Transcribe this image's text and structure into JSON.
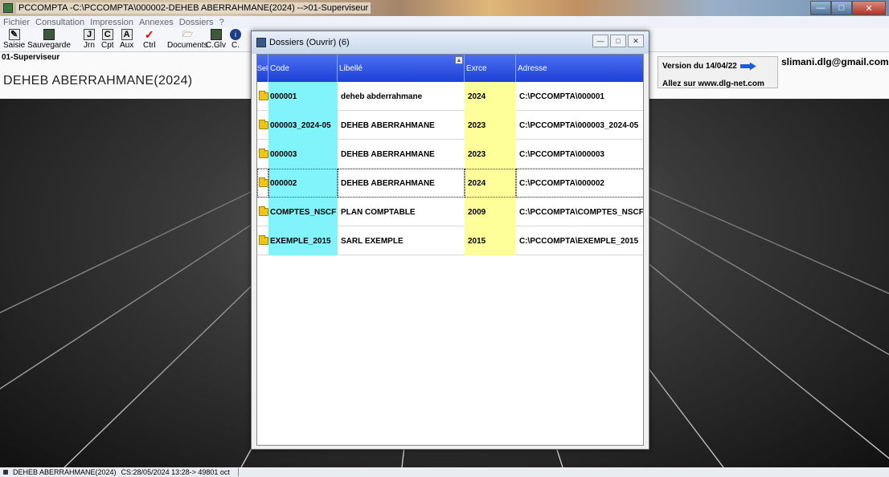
{
  "window": {
    "title": "PCCOMPTA -C:\\PCCOMPTA\\000002-DEHEB ABERRAHMANE(2024) -->01-Superviseur"
  },
  "menu": [
    "Fichier",
    "Consultation",
    "Impression",
    "Annexes",
    "Dossiers",
    "?"
  ],
  "toolbar": [
    {
      "label": "Saisie",
      "icon": "edit-icon"
    },
    {
      "label": "Sauvegarde",
      "icon": "save-icon"
    },
    {
      "label": "Jrn",
      "icon": "journal-icon"
    },
    {
      "label": "Cpt",
      "icon": "account-icon"
    },
    {
      "label": "Aux",
      "icon": "auxiliary-icon"
    },
    {
      "label": "Ctrl",
      "icon": "checkmark-icon"
    },
    {
      "label": "Documents",
      "icon": "folder-open-icon"
    },
    {
      "label": "C.Glv",
      "icon": "chart-icon"
    },
    {
      "label": "C.",
      "icon": "info-icon"
    }
  ],
  "header": {
    "user": "01-Superviseur",
    "dossier": "DEHEB ABERRAHMANE(2024)",
    "version": "Version du 14/04/22",
    "website": "Allez sur  www.dlg-net.com",
    "email": "slimani.dlg@gmail.com"
  },
  "dialog": {
    "title": "Dossiers (Ouvrir) (6)",
    "columns": [
      "Sel",
      "Code",
      "Libellé",
      "Exrce",
      "Adresse"
    ],
    "rows": [
      {
        "code": "000001",
        "libelle": "deheb abderrahmane",
        "exercice": "2024",
        "adresse": "C:\\PCCOMPTA\\000001"
      },
      {
        "code": "000003_2024-05",
        "libelle": "DEHEB ABERRAHMANE",
        "exercice": "2023",
        "adresse": "C:\\PCCOMPTA\\000003_2024-05"
      },
      {
        "code": "000003",
        "libelle": "DEHEB ABERRAHMANE",
        "exercice": "2023",
        "adresse": "C:\\PCCOMPTA\\000003"
      },
      {
        "code": "000002",
        "libelle": "DEHEB ABERRAHMANE",
        "exercice": "2024",
        "adresse": "C:\\PCCOMPTA\\000002"
      },
      {
        "code": "COMPTES_NSCF",
        "libelle": "PLAN COMPTABLE",
        "exercice": "2009",
        "adresse": "C:\\PCCOMPTA\\COMPTES_NSCF"
      },
      {
        "code": "EXEMPLE_2015",
        "libelle": "SARL EXEMPLE",
        "exercice": "2015",
        "adresse": "C:\\PCCOMPTA\\EXEMPLE_2015"
      }
    ]
  },
  "status": {
    "dossier": "DEHEB ABERRAHMANE(2024)",
    "info": "CS:28/05/2024 13:28->  49801 oct"
  },
  "colors": {
    "code_column": "#80f3fb",
    "exercice_column": "#ffff99",
    "grid_header": "#2a4ee0"
  }
}
